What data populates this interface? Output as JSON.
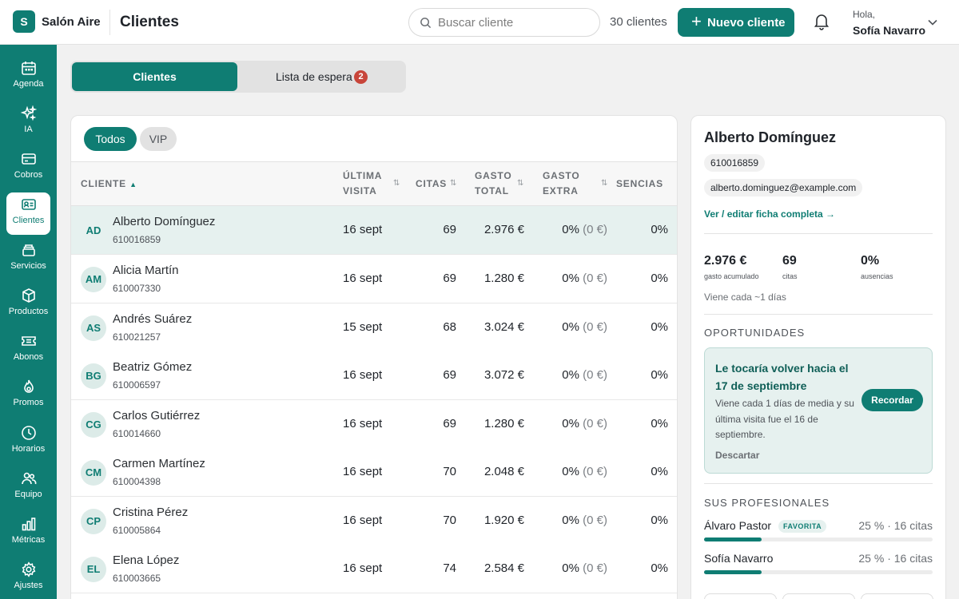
{
  "header": {
    "logo_letter": "S",
    "brand": "Salón Aire",
    "title": "Clientes",
    "search_placeholder": "Buscar cliente",
    "client_count": "30 clientes",
    "new_client_label": "Nuevo cliente",
    "greeting": "Hola,",
    "user_name": "Sofía Navarro"
  },
  "sidebar": {
    "items": [
      {
        "label": "Agenda",
        "icon": "calendar-icon"
      },
      {
        "label": "IA",
        "icon": "sparkles-icon"
      },
      {
        "label": "Cobros",
        "icon": "credit-card-icon"
      },
      {
        "label": "Clientes",
        "icon": "id-card-icon",
        "active": true
      },
      {
        "label": "Servicios",
        "icon": "stack-icon"
      },
      {
        "label": "Productos",
        "icon": "box-icon"
      },
      {
        "label": "Abonos",
        "icon": "ticket-icon"
      },
      {
        "label": "Promos",
        "icon": "flame-icon"
      },
      {
        "label": "Horarios",
        "icon": "clock-icon"
      },
      {
        "label": "Equipo",
        "icon": "users-icon"
      },
      {
        "label": "Métricas",
        "icon": "bar-chart-icon"
      },
      {
        "label": "Ajustes",
        "icon": "gear-icon"
      }
    ]
  },
  "tabs": {
    "clientes": "Clientes",
    "lista_espera": "Lista de espera",
    "lista_espera_count": "2"
  },
  "filters": {
    "todos": "Todos",
    "vip": "VIP"
  },
  "table": {
    "columns": {
      "cliente": "CLIENTE",
      "ultima_1": "ÚLTIMA",
      "ultima_2": "VISITA",
      "citas": "CITAS",
      "gasto_total_1": "GASTO",
      "gasto_total_2": "TOTAL",
      "gasto_extra_1": "GASTO",
      "gasto_extra_2": "EXTRA",
      "ausencias": "SENCIAS"
    },
    "rows": [
      {
        "initials": "AD",
        "name": "Alberto Domínguez",
        "phone": "610016859",
        "last": "16 sept",
        "citas": "69",
        "gasto": "2.976 €",
        "extra": "0%",
        "extra_amt": "(0 €)",
        "aus": "0%"
      },
      {
        "initials": "AM",
        "name": "Alicia Martín",
        "phone": "610007330",
        "last": "16 sept",
        "citas": "69",
        "gasto": "1.280 €",
        "extra": "0%",
        "extra_amt": "(0 €)",
        "aus": "0%"
      },
      {
        "initials": "AS",
        "name": "Andrés Suárez",
        "phone": "610021257",
        "last": "15 sept",
        "citas": "68",
        "gasto": "3.024 €",
        "extra": "0%",
        "extra_amt": "(0 €)",
        "aus": "0%"
      },
      {
        "initials": "BG",
        "name": "Beatriz Gómez",
        "phone": "610006597",
        "last": "16 sept",
        "citas": "69",
        "gasto": "3.072 €",
        "extra": "0%",
        "extra_amt": "(0 €)",
        "aus": "0%"
      },
      {
        "initials": "CG",
        "name": "Carlos Gutiérrez",
        "phone": "610014660",
        "last": "16 sept",
        "citas": "69",
        "gasto": "1.280 €",
        "extra": "0%",
        "extra_amt": "(0 €)",
        "aus": "0%"
      },
      {
        "initials": "CM",
        "name": "Carmen Martínez",
        "phone": "610004398",
        "last": "16 sept",
        "citas": "70",
        "gasto": "2.048 €",
        "extra": "0%",
        "extra_amt": "(0 €)",
        "aus": "0%"
      },
      {
        "initials": "CP",
        "name": "Cristina Pérez",
        "phone": "610005864",
        "last": "16 sept",
        "citas": "70",
        "gasto": "1.920 €",
        "extra": "0%",
        "extra_amt": "(0 €)",
        "aus": "0%"
      },
      {
        "initials": "EL",
        "name": "Elena López",
        "phone": "610003665",
        "last": "16 sept",
        "citas": "74",
        "gasto": "2.584 €",
        "extra": "0%",
        "extra_amt": "(0 €)",
        "aus": "0%"
      }
    ]
  },
  "detail": {
    "name": "Alberto Domínguez",
    "phone": "610016859",
    "email": "alberto.dominguez@example.com",
    "link": "Ver / editar ficha completa →",
    "stats": [
      {
        "value": "2.976 €",
        "label": "gasto acumulado"
      },
      {
        "value": "69",
        "label": "citas"
      },
      {
        "value": "0%",
        "label": "ausencias"
      }
    ],
    "frequency": "Viene cada ~1 días",
    "opportunities_heading": "OPORTUNIDADES",
    "opportunity": {
      "title": "Le tocaría volver hacia el 17 de septiembre",
      "desc": "Viene cada 1 días de media y su última visita fue el 16 de septiembre.",
      "remind": "Recordar",
      "dismiss": "Descartar"
    },
    "professionals_heading": "SUS PROFESIONALES",
    "professionals": [
      {
        "name": "Álvaro Pastor",
        "badge": "FAVORITA",
        "share": "25 % · 16 citas",
        "fraction": 0.25
      },
      {
        "name": "Sofía Navarro",
        "badge": "",
        "share": "25 % · 16 citas",
        "fraction": 0.25
      }
    ]
  },
  "colors": {
    "accent": "#0f7d73",
    "badge": "#c8453a",
    "selected_row": "#e6f1ef"
  }
}
